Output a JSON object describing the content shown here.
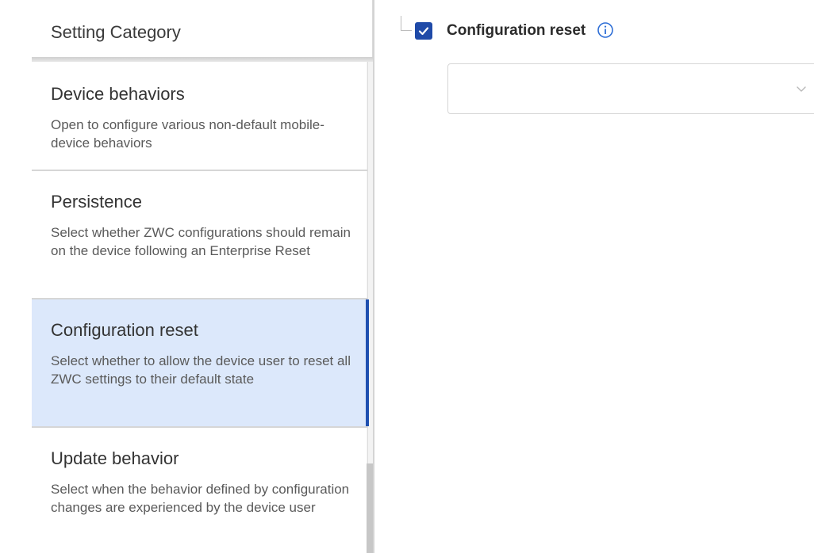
{
  "sidebar": {
    "header": "Setting Category",
    "items": [
      {
        "label": "Device behaviors",
        "description": "Open to configure various non-default mobile-device behaviors"
      },
      {
        "label": "Persistence",
        "description": "Select whether ZWC configurations should remain on the device following an Enterprise Reset"
      },
      {
        "label": "Configuration reset",
        "description": "Select whether to allow the device user to reset all ZWC settings to their default state",
        "selected": true
      },
      {
        "label": "Update behavior",
        "description": "Select when the behavior defined by configuration changes are experienced by the device user"
      }
    ]
  },
  "content": {
    "setting_label": "Configuration reset",
    "checkbox_checked": true,
    "info_icon": "info-circle-icon",
    "dropdown": {
      "selected_value": "",
      "icon": "chevron-down-icon"
    }
  },
  "colors": {
    "accent": "#1f4aa8",
    "selected_bg": "#dce8fb",
    "info": "#2f6fd6"
  }
}
